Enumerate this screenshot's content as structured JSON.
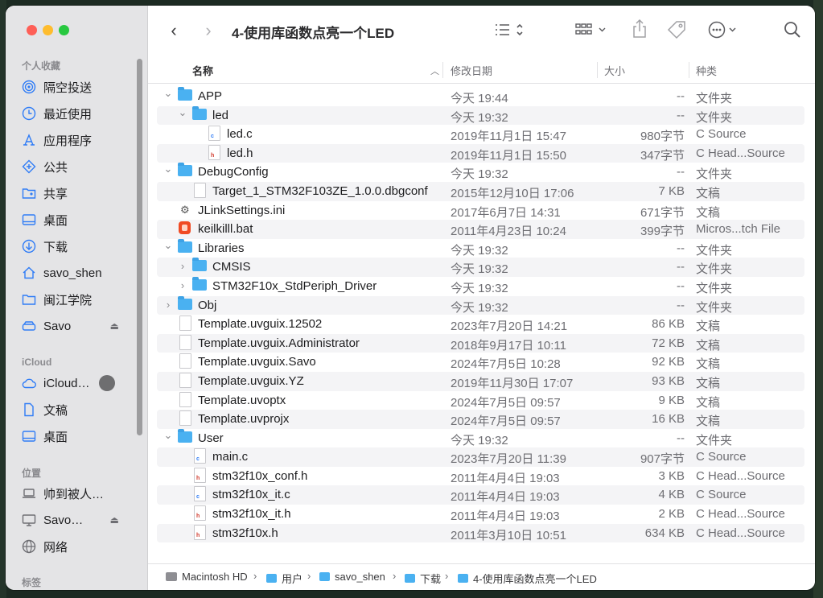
{
  "window": {
    "title": "4-使用库函数点亮一个LED"
  },
  "sidebar": {
    "favorites_header": "个人收藏",
    "favorites": [
      {
        "label": "隔空投送",
        "icon": "airdrop-icon"
      },
      {
        "label": "最近使用",
        "icon": "clock-icon"
      },
      {
        "label": "应用程序",
        "icon": "applications-icon"
      },
      {
        "label": "公共",
        "icon": "public-folder-icon"
      },
      {
        "label": "共享",
        "icon": "shared-folder-icon"
      },
      {
        "label": "桌面",
        "icon": "desktop-icon"
      },
      {
        "label": "下载",
        "icon": "download-icon"
      },
      {
        "label": "savo_shen",
        "icon": "home-icon"
      },
      {
        "label": "闽江学院",
        "icon": "folder-icon"
      },
      {
        "label": "Savo",
        "icon": "drive-icon"
      }
    ],
    "icloud_header": "iCloud",
    "icloud": [
      {
        "label": "iCloud…",
        "icon": "cloud-icon"
      },
      {
        "label": "文稿",
        "icon": "document-icon"
      },
      {
        "label": "桌面",
        "icon": "desktop-icon"
      }
    ],
    "locations_header": "位置",
    "locations": [
      {
        "label": "帅到被人…",
        "icon": "laptop-icon"
      },
      {
        "label": "Savo…",
        "icon": "display-icon"
      },
      {
        "label": "网络",
        "icon": "network-icon"
      }
    ],
    "tags_header": "标签"
  },
  "columns": {
    "name": "名称",
    "date": "修改日期",
    "size": "大小",
    "kind": "种类"
  },
  "files": [
    {
      "name": "APP",
      "date": "今天 19:44",
      "size": "--",
      "kind": "文件夹",
      "level": 0,
      "type": "folder",
      "expanded": true
    },
    {
      "name": "led",
      "date": "今天 19:32",
      "size": "--",
      "kind": "文件夹",
      "level": 1,
      "type": "folder",
      "expanded": true
    },
    {
      "name": "led.c",
      "date": "2019年11月1日 15:47",
      "size": "980字节",
      "kind": "C Source",
      "level": 2,
      "type": "c"
    },
    {
      "name": "led.h",
      "date": "2019年11月1日 15:50",
      "size": "347字节",
      "kind": "C Head...Source",
      "level": 2,
      "type": "h"
    },
    {
      "name": "DebugConfig",
      "date": "今天 19:32",
      "size": "--",
      "kind": "文件夹",
      "level": 0,
      "type": "folder",
      "expanded": true
    },
    {
      "name": "Target_1_STM32F103ZE_1.0.0.dbgconf",
      "date": "2015年12月10日 17:06",
      "size": "7 KB",
      "kind": "文稿",
      "level": 1,
      "type": "doc"
    },
    {
      "name": "JLinkSettings.ini",
      "date": "2017年6月7日 14:31",
      "size": "671字节",
      "kind": "文稿",
      "level": 0,
      "type": "gear"
    },
    {
      "name": "keilkilll.bat",
      "date": "2011年4月23日 10:24",
      "size": "399字节",
      "kind": "Micros...tch File",
      "level": 0,
      "type": "bat"
    },
    {
      "name": "Libraries",
      "date": "今天 19:32",
      "size": "--",
      "kind": "文件夹",
      "level": 0,
      "type": "folder",
      "expanded": true
    },
    {
      "name": "CMSIS",
      "date": "今天 19:32",
      "size": "--",
      "kind": "文件夹",
      "level": 1,
      "type": "folder",
      "expanded": false
    },
    {
      "name": "STM32F10x_StdPeriph_Driver",
      "date": "今天 19:32",
      "size": "--",
      "kind": "文件夹",
      "level": 1,
      "type": "folder",
      "expanded": false
    },
    {
      "name": "Obj",
      "date": "今天 19:32",
      "size": "--",
      "kind": "文件夹",
      "level": 0,
      "type": "folder",
      "expanded": false
    },
    {
      "name": "Template.uvguix.12502",
      "date": "2023年7月20日 14:21",
      "size": "86 KB",
      "kind": "文稿",
      "level": 0,
      "type": "doc"
    },
    {
      "name": "Template.uvguix.Administrator",
      "date": "2018年9月17日 10:11",
      "size": "72 KB",
      "kind": "文稿",
      "level": 0,
      "type": "doc"
    },
    {
      "name": "Template.uvguix.Savo",
      "date": "2024年7月5日 10:28",
      "size": "92 KB",
      "kind": "文稿",
      "level": 0,
      "type": "doc"
    },
    {
      "name": "Template.uvguix.YZ",
      "date": "2019年11月30日 17:07",
      "size": "93 KB",
      "kind": "文稿",
      "level": 0,
      "type": "doc"
    },
    {
      "name": "Template.uvoptx",
      "date": "2024年7月5日 09:57",
      "size": "9 KB",
      "kind": "文稿",
      "level": 0,
      "type": "doc"
    },
    {
      "name": "Template.uvprojx",
      "date": "2024年7月5日 09:57",
      "size": "16 KB",
      "kind": "文稿",
      "level": 0,
      "type": "doc"
    },
    {
      "name": "User",
      "date": "今天 19:32",
      "size": "--",
      "kind": "文件夹",
      "level": 0,
      "type": "folder",
      "expanded": true
    },
    {
      "name": "main.c",
      "date": "2023年7月20日 11:39",
      "size": "907字节",
      "kind": "C Source",
      "level": 1,
      "type": "c"
    },
    {
      "name": "stm32f10x_conf.h",
      "date": "2011年4月4日 19:03",
      "size": "3 KB",
      "kind": "C Head...Source",
      "level": 1,
      "type": "h"
    },
    {
      "name": "stm32f10x_it.c",
      "date": "2011年4月4日 19:03",
      "size": "4 KB",
      "kind": "C Source",
      "level": 1,
      "type": "c"
    },
    {
      "name": "stm32f10x_it.h",
      "date": "2011年4月4日 19:03",
      "size": "2 KB",
      "kind": "C Head...Source",
      "level": 1,
      "type": "h"
    },
    {
      "name": "stm32f10x.h",
      "date": "2011年3月10日 10:51",
      "size": "634 KB",
      "kind": "C Head...Source",
      "level": 1,
      "type": "h"
    }
  ],
  "pathbar": [
    {
      "label": "Macintosh HD",
      "icon": "hd-icon"
    },
    {
      "label": "用户",
      "icon": "folder-icon"
    },
    {
      "label": "savo_shen",
      "icon": "home-folder-icon"
    },
    {
      "label": "下载",
      "icon": "download-folder-icon"
    },
    {
      "label": "4-使用库函数点亮一个LED",
      "icon": "folder-icon"
    }
  ],
  "colors": {
    "accent": "#2f7cf6",
    "folder": "#4ab1f1",
    "sidebar_bg": "#e4e4e6"
  }
}
